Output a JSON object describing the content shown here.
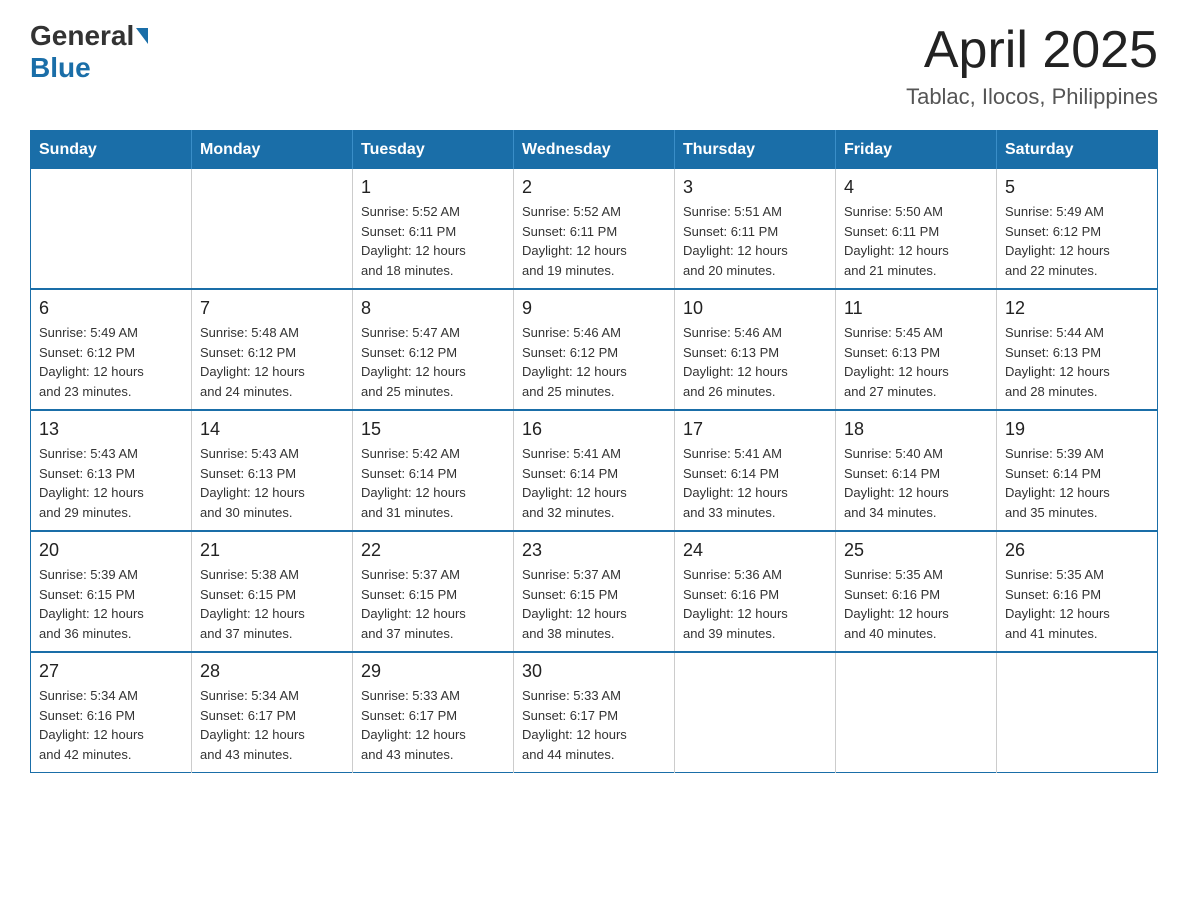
{
  "header": {
    "logo": {
      "general": "General",
      "blue": "Blue"
    },
    "month": "April 2025",
    "location": "Tablac, Ilocos, Philippines"
  },
  "weekdays": [
    "Sunday",
    "Monday",
    "Tuesday",
    "Wednesday",
    "Thursday",
    "Friday",
    "Saturday"
  ],
  "weeks": [
    [
      {
        "day": "",
        "info": ""
      },
      {
        "day": "",
        "info": ""
      },
      {
        "day": "1",
        "info": "Sunrise: 5:52 AM\nSunset: 6:11 PM\nDaylight: 12 hours\nand 18 minutes."
      },
      {
        "day": "2",
        "info": "Sunrise: 5:52 AM\nSunset: 6:11 PM\nDaylight: 12 hours\nand 19 minutes."
      },
      {
        "day": "3",
        "info": "Sunrise: 5:51 AM\nSunset: 6:11 PM\nDaylight: 12 hours\nand 20 minutes."
      },
      {
        "day": "4",
        "info": "Sunrise: 5:50 AM\nSunset: 6:11 PM\nDaylight: 12 hours\nand 21 minutes."
      },
      {
        "day": "5",
        "info": "Sunrise: 5:49 AM\nSunset: 6:12 PM\nDaylight: 12 hours\nand 22 minutes."
      }
    ],
    [
      {
        "day": "6",
        "info": "Sunrise: 5:49 AM\nSunset: 6:12 PM\nDaylight: 12 hours\nand 23 minutes."
      },
      {
        "day": "7",
        "info": "Sunrise: 5:48 AM\nSunset: 6:12 PM\nDaylight: 12 hours\nand 24 minutes."
      },
      {
        "day": "8",
        "info": "Sunrise: 5:47 AM\nSunset: 6:12 PM\nDaylight: 12 hours\nand 25 minutes."
      },
      {
        "day": "9",
        "info": "Sunrise: 5:46 AM\nSunset: 6:12 PM\nDaylight: 12 hours\nand 25 minutes."
      },
      {
        "day": "10",
        "info": "Sunrise: 5:46 AM\nSunset: 6:13 PM\nDaylight: 12 hours\nand 26 minutes."
      },
      {
        "day": "11",
        "info": "Sunrise: 5:45 AM\nSunset: 6:13 PM\nDaylight: 12 hours\nand 27 minutes."
      },
      {
        "day": "12",
        "info": "Sunrise: 5:44 AM\nSunset: 6:13 PM\nDaylight: 12 hours\nand 28 minutes."
      }
    ],
    [
      {
        "day": "13",
        "info": "Sunrise: 5:43 AM\nSunset: 6:13 PM\nDaylight: 12 hours\nand 29 minutes."
      },
      {
        "day": "14",
        "info": "Sunrise: 5:43 AM\nSunset: 6:13 PM\nDaylight: 12 hours\nand 30 minutes."
      },
      {
        "day": "15",
        "info": "Sunrise: 5:42 AM\nSunset: 6:14 PM\nDaylight: 12 hours\nand 31 minutes."
      },
      {
        "day": "16",
        "info": "Sunrise: 5:41 AM\nSunset: 6:14 PM\nDaylight: 12 hours\nand 32 minutes."
      },
      {
        "day": "17",
        "info": "Sunrise: 5:41 AM\nSunset: 6:14 PM\nDaylight: 12 hours\nand 33 minutes."
      },
      {
        "day": "18",
        "info": "Sunrise: 5:40 AM\nSunset: 6:14 PM\nDaylight: 12 hours\nand 34 minutes."
      },
      {
        "day": "19",
        "info": "Sunrise: 5:39 AM\nSunset: 6:14 PM\nDaylight: 12 hours\nand 35 minutes."
      }
    ],
    [
      {
        "day": "20",
        "info": "Sunrise: 5:39 AM\nSunset: 6:15 PM\nDaylight: 12 hours\nand 36 minutes."
      },
      {
        "day": "21",
        "info": "Sunrise: 5:38 AM\nSunset: 6:15 PM\nDaylight: 12 hours\nand 37 minutes."
      },
      {
        "day": "22",
        "info": "Sunrise: 5:37 AM\nSunset: 6:15 PM\nDaylight: 12 hours\nand 37 minutes."
      },
      {
        "day": "23",
        "info": "Sunrise: 5:37 AM\nSunset: 6:15 PM\nDaylight: 12 hours\nand 38 minutes."
      },
      {
        "day": "24",
        "info": "Sunrise: 5:36 AM\nSunset: 6:16 PM\nDaylight: 12 hours\nand 39 minutes."
      },
      {
        "day": "25",
        "info": "Sunrise: 5:35 AM\nSunset: 6:16 PM\nDaylight: 12 hours\nand 40 minutes."
      },
      {
        "day": "26",
        "info": "Sunrise: 5:35 AM\nSunset: 6:16 PM\nDaylight: 12 hours\nand 41 minutes."
      }
    ],
    [
      {
        "day": "27",
        "info": "Sunrise: 5:34 AM\nSunset: 6:16 PM\nDaylight: 12 hours\nand 42 minutes."
      },
      {
        "day": "28",
        "info": "Sunrise: 5:34 AM\nSunset: 6:17 PM\nDaylight: 12 hours\nand 43 minutes."
      },
      {
        "day": "29",
        "info": "Sunrise: 5:33 AM\nSunset: 6:17 PM\nDaylight: 12 hours\nand 43 minutes."
      },
      {
        "day": "30",
        "info": "Sunrise: 5:33 AM\nSunset: 6:17 PM\nDaylight: 12 hours\nand 44 minutes."
      },
      {
        "day": "",
        "info": ""
      },
      {
        "day": "",
        "info": ""
      },
      {
        "day": "",
        "info": ""
      }
    ]
  ]
}
